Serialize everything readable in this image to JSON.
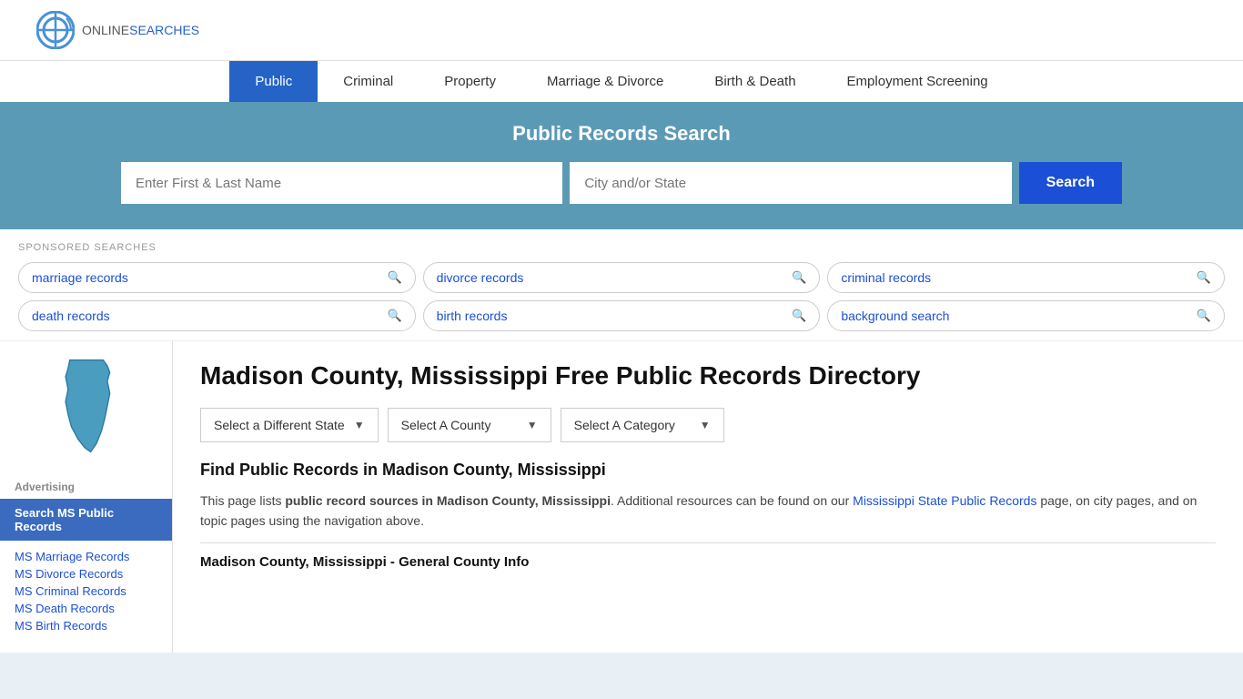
{
  "logo": {
    "online": "ONLINE",
    "searches": "SEARCHES"
  },
  "nav": {
    "items": [
      {
        "label": "Public",
        "active": true
      },
      {
        "label": "Criminal",
        "active": false
      },
      {
        "label": "Property",
        "active": false
      },
      {
        "label": "Marriage & Divorce",
        "active": false
      },
      {
        "label": "Birth & Death",
        "active": false
      },
      {
        "label": "Employment Screening",
        "active": false
      }
    ]
  },
  "search_banner": {
    "title": "Public Records Search",
    "name_placeholder": "Enter First & Last Name",
    "location_placeholder": "City and/or State",
    "button_label": "Search"
  },
  "sponsored": {
    "label": "SPONSORED SEARCHES",
    "pills": [
      {
        "text": "marriage records"
      },
      {
        "text": "divorce records"
      },
      {
        "text": "criminal records"
      },
      {
        "text": "death records"
      },
      {
        "text": "birth records"
      },
      {
        "text": "background search"
      }
    ]
  },
  "sidebar": {
    "ads_label": "Advertising",
    "ad_highlight": "Search MS Public Records",
    "links": [
      {
        "label": "MS Marriage Records"
      },
      {
        "label": "MS Divorce Records"
      },
      {
        "label": "MS Criminal Records"
      },
      {
        "label": "MS Death Records"
      },
      {
        "label": "MS Birth Records"
      }
    ]
  },
  "content": {
    "heading": "Madison County, Mississippi Free Public Records Directory",
    "dropdowns": {
      "state_label": "Select a Different State",
      "county_label": "Select A County",
      "category_label": "Select A Category"
    },
    "find_heading": "Find Public Records in Madison County, Mississippi",
    "description_part1": "This page lists ",
    "description_bold": "public record sources in Madison County, Mississippi",
    "description_part2": ". Additional resources can be found on our ",
    "description_link": "Mississippi State Public Records",
    "description_part3": " page, on city pages, and on topic pages using the navigation above.",
    "county_info_heading": "Madison County, Mississippi - General County Info"
  }
}
